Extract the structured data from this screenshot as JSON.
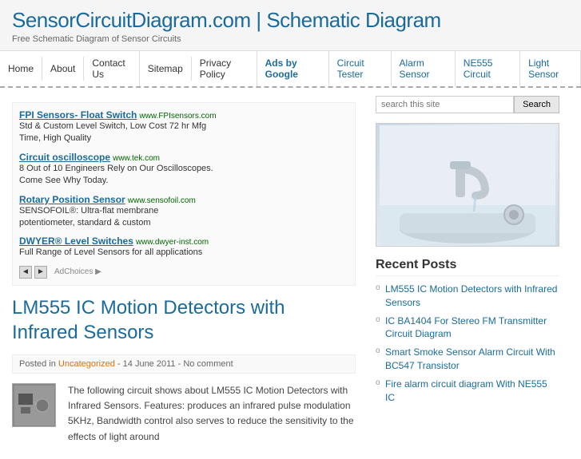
{
  "header": {
    "title": "SensorCircuitDiagram.com | Schematic Diagram",
    "tagline": "Free Schematic Diagram of Sensor Circuits"
  },
  "nav": {
    "items": [
      {
        "label": "Home",
        "active": false
      },
      {
        "label": "About",
        "active": false
      },
      {
        "label": "Contact Us",
        "active": false
      },
      {
        "label": "Sitemap",
        "active": false
      },
      {
        "label": "Privacy Policy",
        "active": false
      },
      {
        "label": "Ads by Google",
        "active": false,
        "ads": true
      },
      {
        "label": "Circuit Tester",
        "active": false,
        "link": true
      },
      {
        "label": "Alarm Sensor",
        "active": false,
        "link": true
      },
      {
        "label": "NE555 Circuit",
        "active": false,
        "link": true
      },
      {
        "label": "Light Sensor",
        "active": false,
        "link": true
      }
    ]
  },
  "ads": {
    "items": [
      {
        "title": "FPI Sensors- Float Switch",
        "url": "www.FPIsensors.com",
        "lines": [
          "Std & Custom Level Switch, Low Cost 72 hr Mfg",
          "Time, High Quality"
        ]
      },
      {
        "title": "Circuit oscilloscope",
        "url": "www.tek.com",
        "lines": [
          "8 Out of 10 Engineers Rely on Our Oscilloscopes.",
          "Come See Why Today."
        ]
      },
      {
        "title": "Rotary Position Sensor",
        "url": "www.sensofoil.com",
        "lines": [
          "SENSOFOIL®: Ultra-flat membrane",
          "potentiometer, standard & custom"
        ]
      },
      {
        "title": "DWYER® Level Switches",
        "url": "www.dwyer-inst.com",
        "lines": [
          "Full Range of Level Sensors for all applications"
        ]
      }
    ],
    "nav_prev": "◄",
    "nav_next": "►",
    "ad_choices": "AdChoices ▶"
  },
  "article": {
    "title": "LM555 IC Motion Detectors with Infrared Sensors",
    "meta": {
      "category": "Uncategorized",
      "date": "14 June 2011",
      "comment": "No comment"
    },
    "body": "The following circuit shows about LM555 IC Motion Detectors with Infrared Sensors. Features: produces an infrared pulse modulation 5KHz, Bandwidth control also serves to reduce the sensitivity to the effects of light around"
  },
  "sidebar": {
    "search_placeholder": "search this site",
    "search_button": "Search",
    "recent_posts_title": "Recent Posts",
    "recent_posts": [
      {
        "label": "LM555 IC Motion Detectors with Infrared Sensors"
      },
      {
        "label": "IC BA1404 For Stereo FM Transmitter Circuit Diagram"
      },
      {
        "label": "Smart Smoke Sensor Alarm Circuit With BC547 Transistor"
      },
      {
        "label": "Fire alarm circuit diagram With NE555 IC"
      }
    ]
  }
}
